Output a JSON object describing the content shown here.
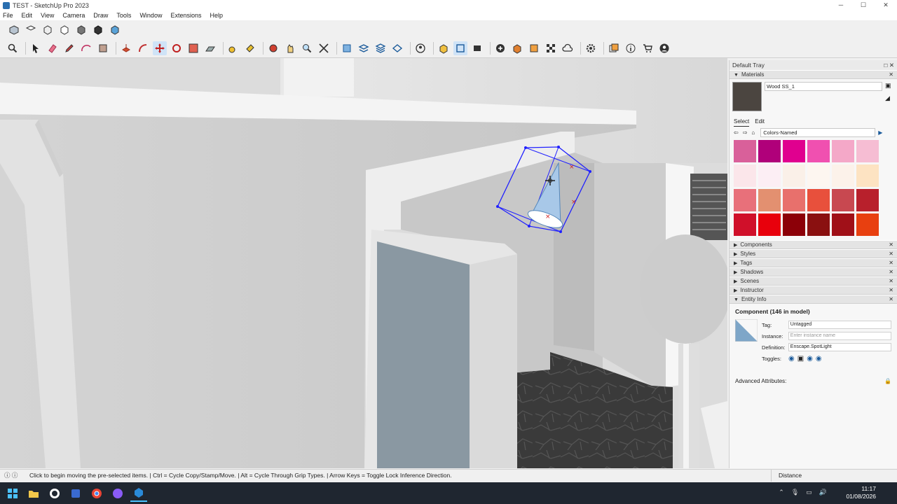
{
  "window": {
    "title": "TEST - SketchUp Pro 2023"
  },
  "menu": [
    "File",
    "Edit",
    "View",
    "Camera",
    "Draw",
    "Tools",
    "Window",
    "Extensions",
    "Help"
  ],
  "tray": {
    "title": "Default Tray",
    "materials": {
      "header": "Materials",
      "current_name": "Wood SS_1",
      "tab_select": "Select",
      "tab_edit": "Edit",
      "library": "Colors-Named",
      "swatches": [
        "#d9609a",
        "#b0007a",
        "#e0008f",
        "#f050b0",
        "#f4a8c8",
        "#f6bdd3",
        "#fbe6ea",
        "#fceef4",
        "#faf0e8",
        "#fdf6f0",
        "#fcf2ea",
        "#fde3c2",
        "#e8707a",
        "#e39070",
        "#e8706c",
        "#e8503c",
        "#c84850",
        "#b8202c",
        "#d0102a",
        "#e8000c",
        "#8c0008",
        "#8a1010",
        "#a01018",
        "#e84010"
      ]
    },
    "panels": [
      "Components",
      "Styles",
      "Tags",
      "Shadows",
      "Scenes",
      "Instructor",
      "Entity Info"
    ],
    "entity_info": {
      "heading": "Component (146 in model)",
      "tag_label": "Tag:",
      "tag_value": "Untagged",
      "instance_label": "Instance:",
      "instance_placeholder": "Enter instance name",
      "definition_label": "Definition:",
      "definition_value": "Enscape.SpotLight",
      "toggles_label": "Toggles:",
      "advanced_label": "Advanced Attributes:"
    }
  },
  "status": {
    "message": "Click to begin moving the pre-selected items. | Ctrl = Cycle Copy/Stamp/Move. | Alt = Cycle Through Grip Types. | Arrow Keys = Toggle Lock Inference Direction.",
    "measure_label": "Distance"
  },
  "taskbar": {
    "time": "11:17",
    "date": "01/08/2026"
  }
}
